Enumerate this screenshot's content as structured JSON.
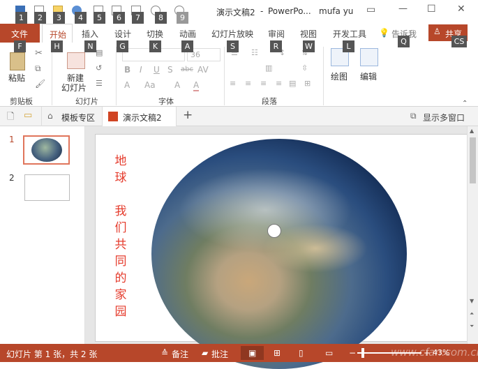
{
  "title": {
    "doc": "演示文稿2",
    "app": "PowerPo...",
    "sep": "-",
    "user": "mufa yu"
  },
  "quick_access_keys": [
    "1",
    "2",
    "3",
    "4",
    "5",
    "6",
    "7",
    "8",
    "9"
  ],
  "window": {
    "minimize": "—",
    "maximize": "☐",
    "close": "✕"
  },
  "tabs": [
    "开始",
    "插入",
    "设计",
    "切换",
    "动画",
    "幻灯片放映",
    "审阅",
    "视图",
    "开发工具"
  ],
  "file_tab": "文件",
  "tell_me": "告诉我",
  "share": "共享",
  "keytips": {
    "file": "F",
    "home": "H",
    "insert": "N",
    "design": "G",
    "trans": "K",
    "anim": "A",
    "show": "S",
    "review": "R",
    "view": "W",
    "dev": "L",
    "tell": "Q",
    "share": "CS"
  },
  "ribbon": {
    "paste": "粘贴",
    "new_slide_1": "新建",
    "new_slide_2": "幻灯片",
    "clipboard": "剪贴板",
    "slides": "幻灯片",
    "font": "字体",
    "paragraph": "段落",
    "drawing": "绘图",
    "editing": "编辑",
    "font_size": "36",
    "bold": "B",
    "italic": "I",
    "underline": "U",
    "strike": "S",
    "abc": "abc",
    "av": "AV",
    "aa": "Aa",
    "a_up": "A",
    "a_down": "A",
    "font_color": "A"
  },
  "doc_tabs": {
    "template": "模板专区",
    "current": "演示文稿2",
    "add": "+",
    "multi_window": "显示多窗口"
  },
  "thumbs": [
    {
      "num": "1"
    },
    {
      "num": "2"
    }
  ],
  "slide": {
    "text1": "地球",
    "text2": "我们共同的家园"
  },
  "status": {
    "info": "幻灯片 第 1 张，共 2 张",
    "notes": "备注",
    "comments": "批注",
    "zoom": "43%",
    "watermark": "www.cfan.com.cn"
  },
  "colors": {
    "accent": "#b7472a",
    "slide_text": "#e53b2c"
  }
}
